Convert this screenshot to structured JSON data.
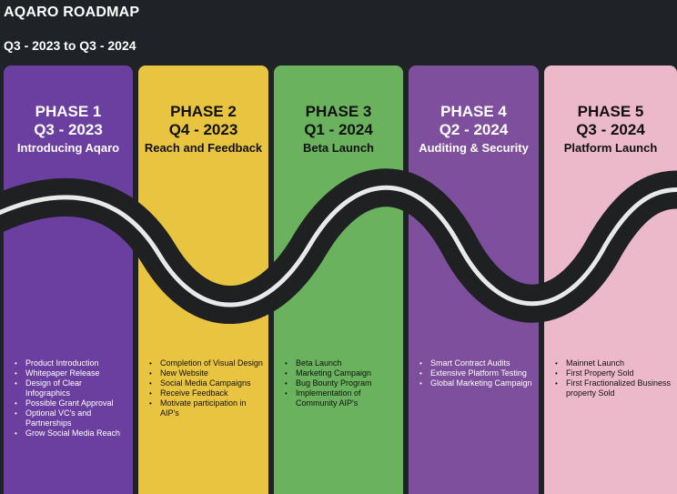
{
  "header": {
    "title": "AQARO ROADMAP",
    "subtitle": "Q3 - 2023 to Q3 - 2024"
  },
  "phases": [
    {
      "name": "PHASE 1",
      "date": "Q3 - 2023",
      "subtitle": "Introducing Aqaro",
      "color": "#6b3fa0",
      "text_color": "#ffffff",
      "items": [
        "Product Introduction",
        "Whitepaper Release",
        "Design of Clear Infographics",
        "Possible Grant Approval",
        "Optional VC's and Partnerships",
        "Grow Social Media Reach"
      ]
    },
    {
      "name": "PHASE 2",
      "date": "Q4 - 2023",
      "subtitle": "Reach and Feedback",
      "color": "#e9c441",
      "text_color": "#111111",
      "items": [
        "Completion of Visual Design",
        "New Website",
        "Social Media Campaigns",
        "Receive Feedback",
        "Motivate participation in AIP's"
      ]
    },
    {
      "name": "PHASE 3",
      "date": "Q1 - 2024",
      "subtitle": "Beta Launch",
      "color": "#6ab25d",
      "text_color": "#111111",
      "items": [
        "Beta Launch",
        "Marketing Campaign",
        "Bug Bounty Program",
        "Implementation of Community AIP's"
      ]
    },
    {
      "name": "PHASE 4",
      "date": "Q2 - 2024",
      "subtitle": "Auditing & Security",
      "color": "#7e4f9d",
      "text_color": "#ffffff",
      "items": [
        "Smart Contract Audits",
        "Extensive Platform Testing",
        "Global Marketing Campaign"
      ]
    },
    {
      "name": "PHASE 5",
      "date": "Q3 - 2024",
      "subtitle": "Platform Launch",
      "color": "#ecb9cb",
      "text_color": "#111111",
      "items": [
        "Mainnet Launch",
        "First Property Sold",
        "First Fractionalized Business property Sold"
      ]
    }
  ],
  "road": {
    "color": "#1e2022",
    "stripe_color": "#e9e9e9"
  }
}
